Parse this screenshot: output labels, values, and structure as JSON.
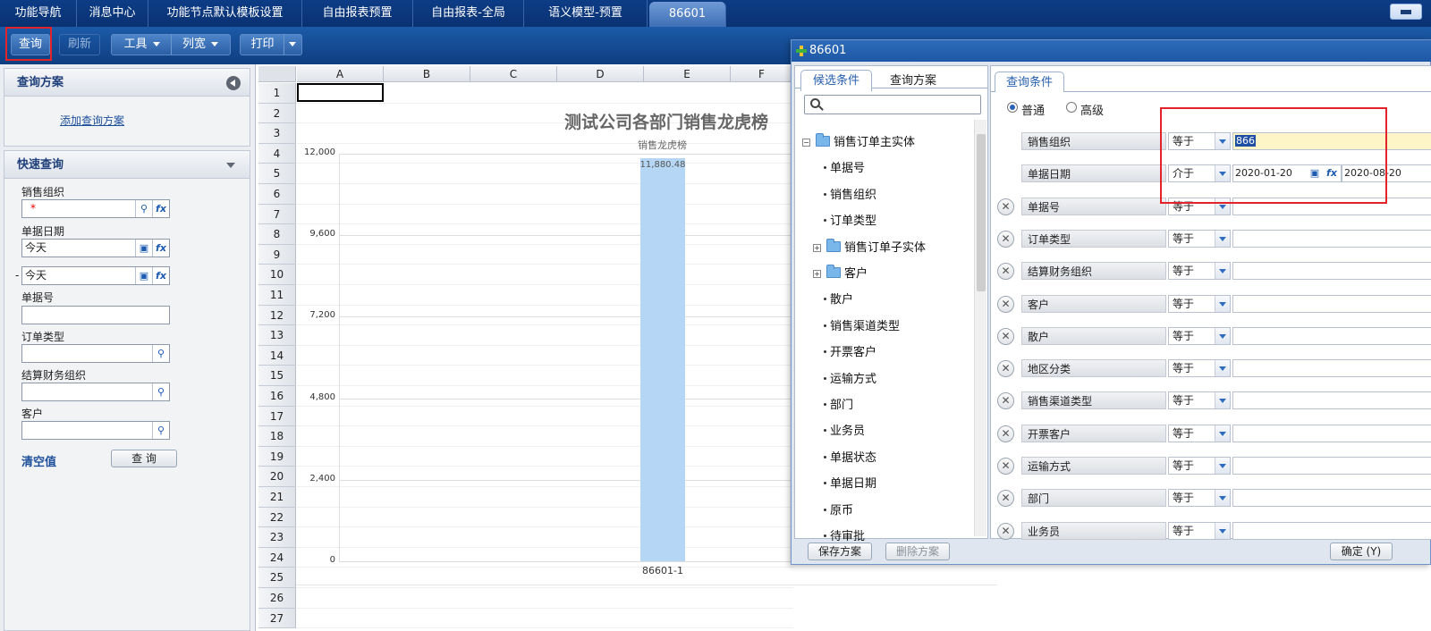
{
  "top_tabs": [
    "功能导航",
    "消息中心",
    "功能节点默认模板设置",
    "自由报表预置",
    "自由报表-全局",
    "语义模型-预置",
    "86601"
  ],
  "toolbar": {
    "query": "查询",
    "refresh": "刷新",
    "tools": "工具",
    "colwidth": "列宽",
    "print": "打印"
  },
  "left": {
    "scheme_title": "查询方案",
    "add_scheme": "添加查询方案",
    "quick_title": "快速查询",
    "fields": [
      {
        "label": "销售组织",
        "value": "*"
      },
      {
        "label": "单据日期",
        "value": "今天"
      },
      {
        "label": "",
        "value": "今天"
      },
      {
        "label": "单据号",
        "value": ""
      },
      {
        "label": "订单类型",
        "value": ""
      },
      {
        "label": "结算财务组织",
        "value": ""
      },
      {
        "label": "客户",
        "value": ""
      }
    ],
    "dash": "-",
    "clear": "清空值",
    "query_btn": "查 询"
  },
  "grid": {
    "cols": [
      "A",
      "B",
      "C",
      "D",
      "E",
      "F"
    ],
    "rows": [
      "1",
      "2",
      "3",
      "4",
      "5",
      "6",
      "7",
      "8",
      "9",
      "10",
      "11",
      "12",
      "13",
      "14",
      "15",
      "16",
      "17",
      "18",
      "19",
      "20",
      "21",
      "22",
      "23",
      "24",
      "25",
      "26",
      "27"
    ]
  },
  "chart_data": {
    "type": "bar",
    "title": "测试公司各部门销售龙虎榜",
    "subtitle": "销售龙虎榜",
    "categories": [
      "86601-1"
    ],
    "values": [
      11880.48
    ],
    "data_labels": [
      "11,880.48"
    ],
    "ylim": [
      0,
      12000
    ],
    "yticks": [
      "0",
      "2,400",
      "4,800",
      "7,200",
      "9,600",
      "12,000"
    ],
    "bar_color": "#b5d7f5",
    "grid": true
  },
  "dialog": {
    "title": "86601",
    "tabs_left": [
      "候选条件",
      "查询方案"
    ],
    "tree": [
      {
        "text": "销售订单主实体",
        "type": "folder-open",
        "level": 0
      },
      {
        "text": "单据号",
        "type": "leaf",
        "level": 1
      },
      {
        "text": "销售组织",
        "type": "leaf",
        "level": 1
      },
      {
        "text": "订单类型",
        "type": "leaf",
        "level": 1
      },
      {
        "text": "销售订单子实体",
        "type": "folder",
        "level": 1
      },
      {
        "text": "客户",
        "type": "folder",
        "level": 1
      },
      {
        "text": "散户",
        "type": "leaf",
        "level": 1
      },
      {
        "text": "销售渠道类型",
        "type": "leaf",
        "level": 1
      },
      {
        "text": "开票客户",
        "type": "leaf",
        "level": 1
      },
      {
        "text": "运输方式",
        "type": "leaf",
        "level": 1
      },
      {
        "text": "部门",
        "type": "leaf",
        "level": 1
      },
      {
        "text": "业务员",
        "type": "leaf",
        "level": 1
      },
      {
        "text": "单据状态",
        "type": "leaf",
        "level": 1
      },
      {
        "text": "单据日期",
        "type": "leaf",
        "level": 1
      },
      {
        "text": "原币",
        "type": "leaf",
        "level": 1
      },
      {
        "text": "待审批",
        "type": "leaf",
        "level": 1
      }
    ],
    "cond_tab": "查询条件",
    "mode_normal": "普通",
    "mode_advanced": "高级",
    "conditions": [
      {
        "name": "销售组织",
        "op": "等于",
        "value": "866",
        "removable": false
      },
      {
        "name": "单据日期",
        "op": "介于",
        "value": "2020-01-20",
        "value2": "2020-08-20",
        "removable": false
      },
      {
        "name": "单据号",
        "op": "等于",
        "value": "",
        "removable": true
      },
      {
        "name": "订单类型",
        "op": "等于",
        "value": "",
        "removable": true
      },
      {
        "name": "结算财务组织",
        "op": "等于",
        "value": "",
        "removable": true
      },
      {
        "name": "客户",
        "op": "等于",
        "value": "",
        "removable": true
      },
      {
        "name": "散户",
        "op": "等于",
        "value": "",
        "removable": true
      },
      {
        "name": "地区分类",
        "op": "等于",
        "value": "",
        "removable": true
      },
      {
        "name": "销售渠道类型",
        "op": "等于",
        "value": "",
        "removable": true
      },
      {
        "name": "开票客户",
        "op": "等于",
        "value": "",
        "removable": true
      },
      {
        "name": "运输方式",
        "op": "等于",
        "value": "",
        "removable": true
      },
      {
        "name": "部门",
        "op": "等于",
        "value": "",
        "removable": true
      },
      {
        "name": "业务员",
        "op": "等于",
        "value": "",
        "removable": true
      }
    ],
    "save_scheme": "保存方案",
    "delete_scheme": "删除方案",
    "ok": "确定 (Y)"
  }
}
